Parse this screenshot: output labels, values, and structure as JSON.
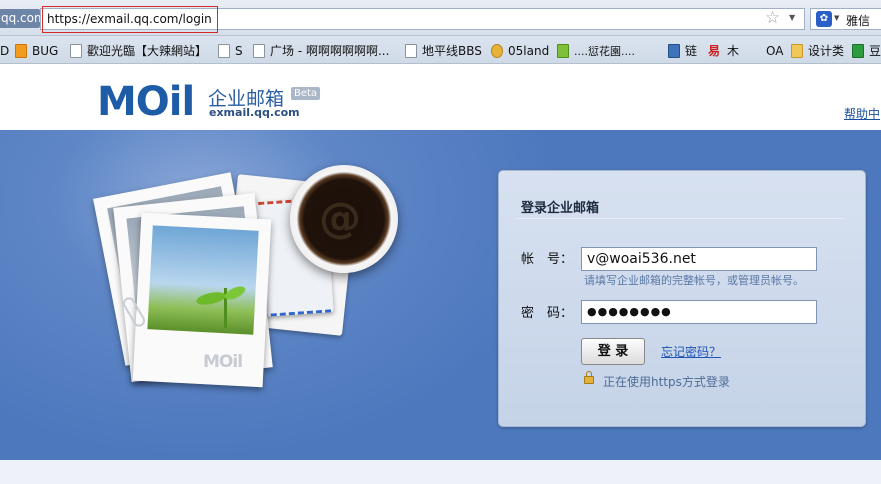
{
  "browser": {
    "url_prefix": "qq.com",
    "url": "https://exmail.qq.com/login",
    "search_engine": "雅信",
    "bookmarks": [
      {
        "label": "D"
      },
      {
        "label": "BUG"
      },
      {
        "label": "歡迎光臨【大辣網站】"
      },
      {
        "label": "S"
      },
      {
        "label": "广场 - 啊啊啊啊啊啊..."
      },
      {
        "label": "地平线BBS"
      },
      {
        "label": "05land"
      },
      {
        "label": "....愆花園...."
      },
      {
        "label": "链"
      },
      {
        "label": "易"
      },
      {
        "label": "木"
      },
      {
        "label": "OA"
      },
      {
        "label": "设计类"
      },
      {
        "label": "豆"
      }
    ]
  },
  "header": {
    "logo": "MOil",
    "title": "企业邮箱",
    "beta": "Beta",
    "domain": "exmail.qq.com",
    "help": "帮助中"
  },
  "illustration": {
    "photo_logo": "MOil"
  },
  "login": {
    "title": "登录企业邮箱",
    "account_label": "帐　号：",
    "account_value": "v@woai536.net",
    "account_hint": "请填写企业邮箱的完整帐号，或管理员帐号。",
    "password_label": "密　码：",
    "password_value": "●●●●●●●●",
    "submit": "登 录",
    "forgot": "忘记密码？",
    "https_note": "正在使用https方式登录"
  }
}
